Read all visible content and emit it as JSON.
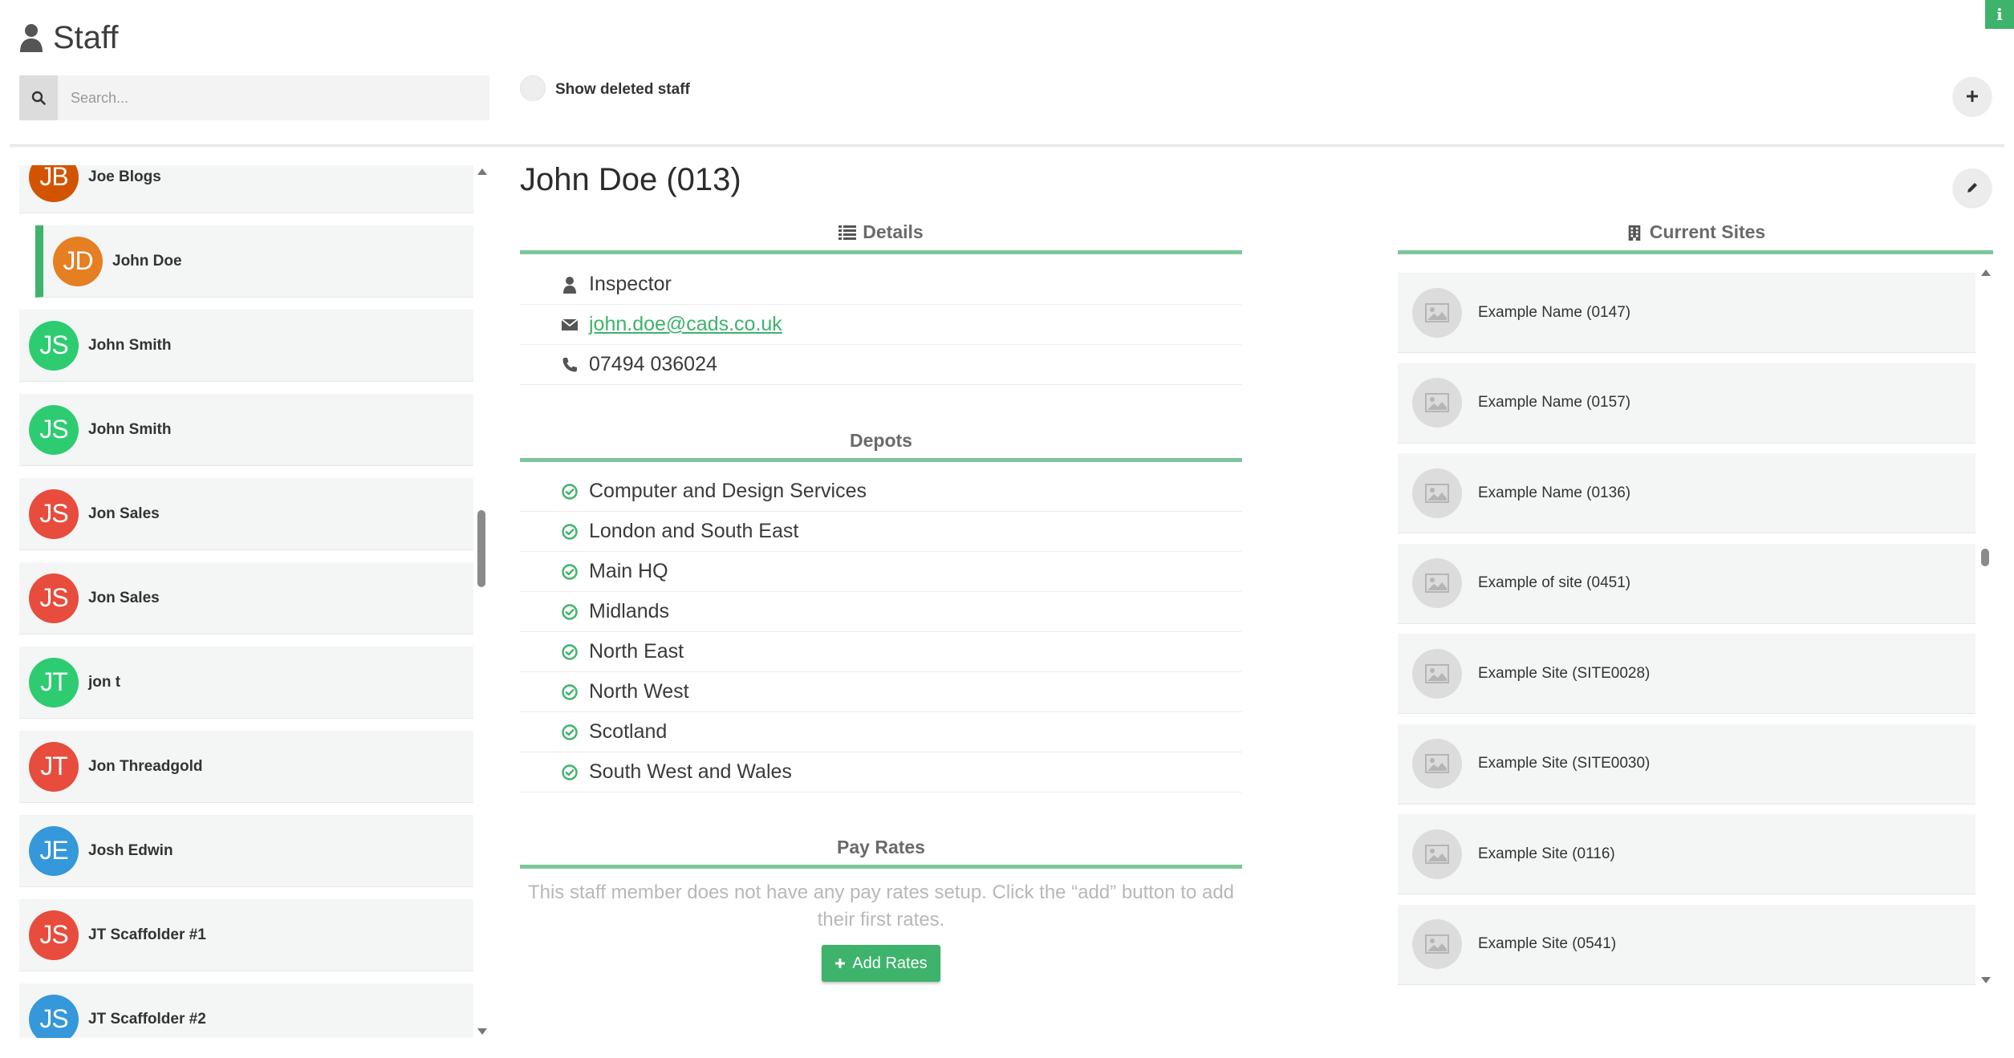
{
  "header": {
    "title": "Staff",
    "info_label": "i",
    "search_placeholder": "Search...",
    "show_deleted_label": "Show deleted staff"
  },
  "staff_list": [
    {
      "initials": "JB",
      "name": "Joe Blogs",
      "color": "#d35400"
    },
    {
      "initials": "JD",
      "name": "John Doe",
      "color": "#e67e22",
      "active": true
    },
    {
      "initials": "JS",
      "name": "John Smith",
      "color": "#2ecc71"
    },
    {
      "initials": "JS",
      "name": "John Smith",
      "color": "#2ecc71"
    },
    {
      "initials": "JS",
      "name": "Jon Sales",
      "color": "#e74c3c"
    },
    {
      "initials": "JS",
      "name": "Jon Sales",
      "color": "#e74c3c"
    },
    {
      "initials": "JT",
      "name": "jon t",
      "color": "#2ecc71"
    },
    {
      "initials": "JT",
      "name": "Jon Threadgold",
      "color": "#e74c3c"
    },
    {
      "initials": "JE",
      "name": "Josh Edwin",
      "color": "#3498db"
    },
    {
      "initials": "JS",
      "name": "JT Scaffolder #1",
      "color": "#e74c3c"
    },
    {
      "initials": "JS",
      "name": "JT Scaffolder #2",
      "color": "#3498db"
    }
  ],
  "staff": {
    "heading": "John Doe (013)",
    "details_title": "Details",
    "role": "Inspector",
    "email": " john.doe@cads.co.uk",
    "phone": "07494 036024"
  },
  "depots": {
    "title": "Depots",
    "items": [
      "Computer and Design Services",
      "London and South East",
      "Main HQ",
      "Midlands",
      "North East",
      "North West",
      "Scotland",
      "South West and Wales"
    ]
  },
  "pay_rates": {
    "title": "Pay Rates",
    "empty_message": "This staff member does not have any pay rates setup. Click the “add” button to add their first rates.",
    "add_label": "Add Rates"
  },
  "sites": {
    "title": "Current Sites",
    "items": [
      "Example Name (0147)",
      "Example Name (0157)",
      "Example Name (0136)",
      "Example of site (0451)",
      "Example Site (SITE0028)",
      "Example Site (SITE0030)",
      "Example Site (0116)",
      "Example Site (0541)"
    ]
  },
  "colors": {
    "accent": "#3db36b",
    "rule": "#7cc69a"
  }
}
